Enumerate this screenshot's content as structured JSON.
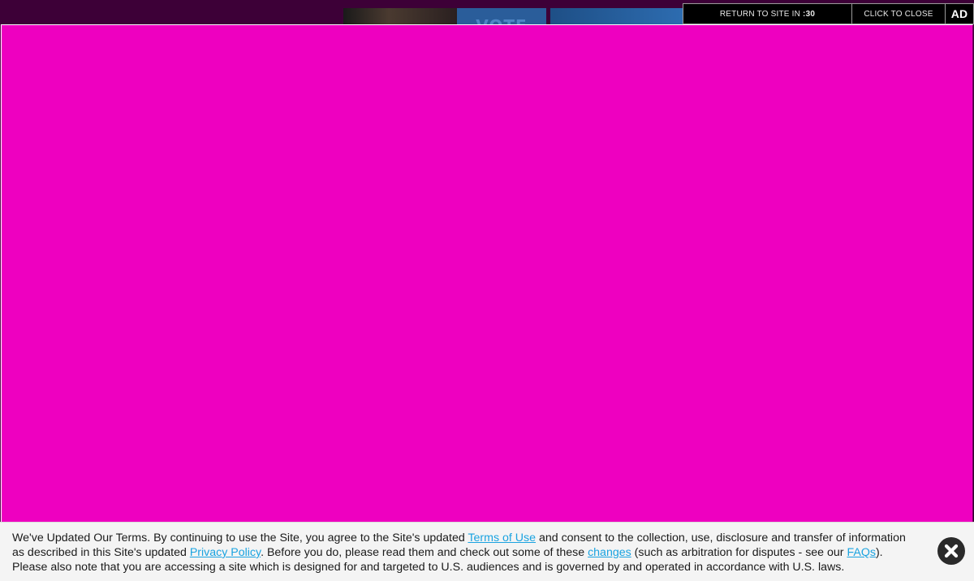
{
  "ad_bar": {
    "return_prefix": "RETURN TO SITE IN",
    "countdown": ":30",
    "close_label": "CLICK TO CLOSE",
    "ad_label": "AD"
  },
  "background_strip": {
    "partial_text": "VOTE"
  },
  "ad_frame": {
    "background_color": "#ee00c0"
  },
  "terms_banner": {
    "line1_text_a": "We've Updated Our Terms. By continuing to use the Site, you agree to the Site's updated ",
    "terms_link": "Terms of Use",
    "line1_text_b": " and consent to the collection, use, disclosure and transfer of information",
    "line2_text_a": "as described in this Site's updated ",
    "privacy_link": "Privacy Policy",
    "line2_text_b": ". Before you do, please read them and check out some of these ",
    "changes_link": "changes",
    "line2_text_c": " (such as arbitration for disputes - see our ",
    "faqs_link": "FAQs",
    "line2_text_d": ").",
    "line3_text": "Please also note that you are accessing a site which is designed for and targeted to U.S. audiences and is governed by and operated in accordance with U.S. laws.",
    "close_icon": "close-x-circle-icon",
    "link_color": "#1aa3e0"
  }
}
